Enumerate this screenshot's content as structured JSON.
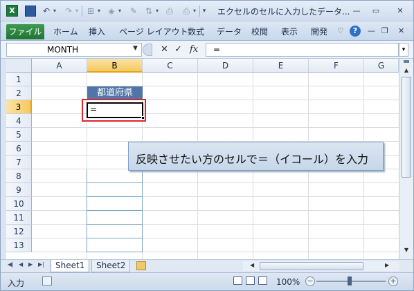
{
  "title": "エクセルのセルに入力したデータ...",
  "app_icon": "excel-icon",
  "ribbon": {
    "file_tab": "ファイル",
    "tabs": [
      "ホーム",
      "挿入",
      "ページ レイアウト",
      "数式",
      "データ",
      "校閲",
      "表示",
      "開発"
    ],
    "help": "?"
  },
  "formula_bar": {
    "name_box": "MONTH",
    "fx": "fx",
    "cancel": "✕",
    "enter": "✓",
    "formula": "="
  },
  "grid": {
    "columns": [
      "A",
      "B",
      "C",
      "D",
      "E",
      "F",
      "G"
    ],
    "selected_column": "B",
    "rows": [
      "1",
      "2",
      "3",
      "4",
      "5",
      "6",
      "7",
      "8",
      "9",
      "10",
      "11",
      "12",
      "13"
    ],
    "selected_row": "3",
    "header_cell": "都道府県",
    "active_cell_value": "="
  },
  "callout": "反映させたい方のセルで＝（イコール）を入力",
  "sheets": {
    "tabs": [
      "Sheet1",
      "Sheet2"
    ],
    "active": "Sheet1"
  },
  "status": {
    "mode": "入力",
    "zoom": "100%"
  },
  "colors": {
    "header_fill": "#4f76a7",
    "highlight_red": "#e0242b",
    "selected_header": "#f5c95f"
  }
}
